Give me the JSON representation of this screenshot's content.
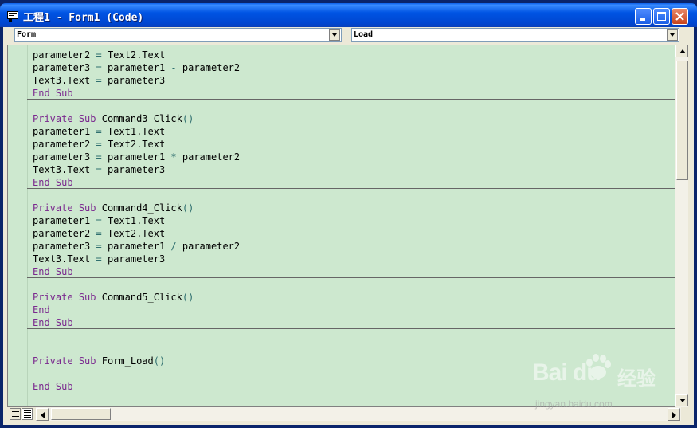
{
  "window": {
    "title": "工程1 - Form1 (Code)"
  },
  "object_combo": {
    "value": "Form"
  },
  "procedure_combo": {
    "value": "Load"
  },
  "code_lines": [
    {
      "t": "parameter2 = Text2.Text"
    },
    {
      "t": "parameter3 = parameter1 - parameter2"
    },
    {
      "t": "Text3.Text = parameter3"
    },
    {
      "t": "End Sub"
    },
    {
      "t": ""
    },
    {
      "t": "Private Sub Command3_Click()"
    },
    {
      "t": "parameter1 = Text1.Text"
    },
    {
      "t": "parameter2 = Text2.Text"
    },
    {
      "t": "parameter3 = parameter1 * parameter2"
    },
    {
      "t": "Text3.Text = parameter3"
    },
    {
      "t": "End Sub"
    },
    {
      "t": ""
    },
    {
      "t": "Private Sub Command4_Click()"
    },
    {
      "t": "parameter1 = Text1.Text"
    },
    {
      "t": "parameter2 = Text2.Text"
    },
    {
      "t": "parameter3 = parameter1 / parameter2"
    },
    {
      "t": "Text3.Text = parameter3"
    },
    {
      "t": "End Sub"
    },
    {
      "t": ""
    },
    {
      "t": "Private Sub Command5_Click()"
    },
    {
      "t": "End"
    },
    {
      "t": "End Sub"
    },
    {
      "t": ""
    },
    {
      "t": ""
    },
    {
      "t": "Private Sub Form_Load()"
    },
    {
      "t": ""
    },
    {
      "t": "End Sub"
    }
  ],
  "watermark": {
    "brand": "Bai du",
    "cn": "经验",
    "url": "jingyan.baidu.com"
  },
  "colors": {
    "editor_bg": "#cde8cf",
    "keyword": "#7b2a8f",
    "title_bar": "#0054e3"
  },
  "icons": [
    "code-window-icon",
    "minimize-icon",
    "maximize-icon",
    "close-icon",
    "dropdown-arrow-icon",
    "scroll-up-icon",
    "scroll-down-icon",
    "scroll-left-icon",
    "scroll-right-icon",
    "procedure-view-icon",
    "full-module-view-icon"
  ]
}
